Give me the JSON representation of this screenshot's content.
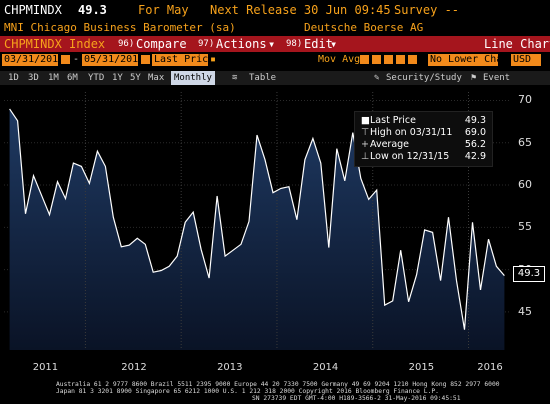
{
  "header": {
    "ticker": "CHPMINDX",
    "last_value": "49.3",
    "period": "For May",
    "next_release": "Next Release 30 Jun 09:45",
    "survey": "Survey --",
    "description": "MNI Chicago Business Barometer (sa)",
    "source": "Deutsche Boerse AG"
  },
  "toolbar": {
    "security": "CHPMINDX Index",
    "compare": "Compare",
    "compare_num": "96)",
    "actions": "Actions",
    "actions_num": "97)",
    "edit": "Edit",
    "edit_num": "98)",
    "chart_type": "Line Chart"
  },
  "controls": {
    "start_date": "03/31/2011",
    "end_date": "05/31/2016",
    "price_field": "Last Price",
    "moving_avg": "Mov Avg",
    "lower_chart": "No Lower Chart",
    "currency": "USD"
  },
  "range_bar": {
    "buttons": [
      "1D",
      "3D",
      "1M",
      "6M",
      "YTD",
      "1Y",
      "5Y",
      "Max"
    ],
    "frequency": "Monthly",
    "table": "Table",
    "security_study": "Security/Study",
    "event": "Event"
  },
  "legend": {
    "last_price_label": "Last Price",
    "last_price_value": "49.3",
    "high_label": "High on 03/31/11",
    "high_value": "69.0",
    "average_label": "Average",
    "average_value": "56.2",
    "low_label": "Low on 12/31/15",
    "low_value": "42.9"
  },
  "last_price_tag": "49.3",
  "footer": {
    "line1": "Australia 61 2 9777 8600 Brazil 5511 2395 9000 Europe 44 20 7330 7500 Germany 49 69 9204 1210 Hong Kong 852 2977 6000",
    "line2": "Japan 81 3 3201 8900          Singapore 65 6212 1000          U.S. 1 212 318 2000         Copyright 2016 Bloomberg Finance L.P.",
    "line3": "SN 273739 EDT  GMT-4:00 H189-3566-2 31-May-2016 09:45:51"
  },
  "colors": {
    "accent_amber": "#f7a21b",
    "toolbar_red": "#a5151d",
    "area_top": "#1f3a63",
    "area_bottom": "#0a1326",
    "line": "#ffffff"
  },
  "chart_data": {
    "type": "area",
    "title": "",
    "xlabel": "",
    "ylabel": "",
    "x_tick_labels": [
      "2011",
      "2012",
      "2013",
      "2014",
      "2015",
      "2016"
    ],
    "y_tick_labels": [
      "45",
      "50",
      "55",
      "60",
      "65",
      "70"
    ],
    "ylim": [
      40.5,
      71
    ],
    "xlim": [
      "2011-03",
      "2016-05"
    ],
    "grid": true,
    "legend_position": "top-right",
    "series": [
      {
        "name": "Last Price",
        "x": [
          "2011-03",
          "2011-04",
          "2011-05",
          "2011-06",
          "2011-07",
          "2011-08",
          "2011-09",
          "2011-10",
          "2011-11",
          "2011-12",
          "2012-01",
          "2012-02",
          "2012-03",
          "2012-04",
          "2012-05",
          "2012-06",
          "2012-07",
          "2012-08",
          "2012-09",
          "2012-10",
          "2012-11",
          "2012-12",
          "2013-01",
          "2013-02",
          "2013-03",
          "2013-04",
          "2013-05",
          "2013-06",
          "2013-07",
          "2013-08",
          "2013-09",
          "2013-10",
          "2013-11",
          "2013-12",
          "2014-01",
          "2014-02",
          "2014-03",
          "2014-04",
          "2014-05",
          "2014-06",
          "2014-07",
          "2014-08",
          "2014-09",
          "2014-10",
          "2014-11",
          "2014-12",
          "2015-01",
          "2015-02",
          "2015-03",
          "2015-04",
          "2015-05",
          "2015-06",
          "2015-07",
          "2015-08",
          "2015-09",
          "2015-10",
          "2015-11",
          "2015-12",
          "2016-01",
          "2016-02",
          "2016-03",
          "2016-04",
          "2016-05"
        ],
        "values": [
          69.0,
          67.6,
          56.6,
          61.1,
          58.8,
          56.5,
          60.4,
          58.4,
          62.6,
          62.2,
          60.2,
          64.0,
          62.2,
          56.2,
          52.7,
          52.9,
          53.7,
          53.0,
          49.7,
          49.9,
          50.4,
          51.6,
          55.6,
          56.8,
          52.4,
          49.0,
          58.7,
          51.6,
          52.3,
          53.0,
          55.7,
          65.9,
          63.0,
          59.1,
          59.6,
          59.8,
          55.9,
          63.0,
          65.5,
          62.6,
          52.6,
          64.3,
          60.5,
          66.2,
          60.8,
          58.3,
          59.4,
          45.8,
          46.3,
          52.3,
          46.2,
          49.4,
          54.7,
          54.4,
          48.7,
          56.2,
          48.7,
          42.9,
          55.6,
          47.6,
          53.6,
          50.4,
          49.3
        ]
      }
    ]
  }
}
